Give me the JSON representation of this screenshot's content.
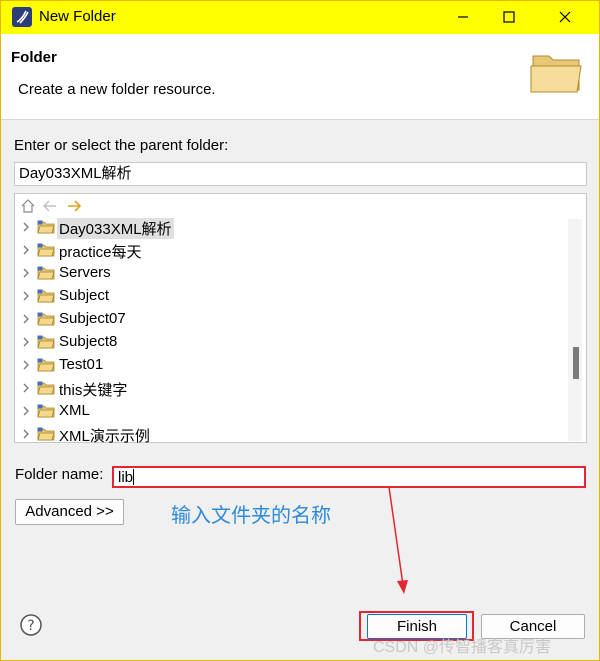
{
  "window": {
    "title": "New Folder",
    "title_bar_color": "#ffff00"
  },
  "banner": {
    "title": "Folder",
    "description": "Create a new folder resource."
  },
  "parent": {
    "prompt": "Enter or select the parent folder:",
    "value": "Day033XML解析"
  },
  "tree": {
    "items": [
      {
        "label": "Day033XML解析",
        "selected": true
      },
      {
        "label": "practice每天"
      },
      {
        "label": "Servers"
      },
      {
        "label": "Subject"
      },
      {
        "label": "Subject07"
      },
      {
        "label": "Subject8"
      },
      {
        "label": "Test01"
      },
      {
        "label": "this关键字"
      },
      {
        "label": "XML"
      },
      {
        "label": "XML演示示例"
      }
    ]
  },
  "folder_name": {
    "label": "Folder name:",
    "value": "lib"
  },
  "buttons": {
    "advanced": "Advanced >>",
    "finish": "Finish",
    "cancel": "Cancel"
  },
  "annotation": {
    "text": "输入文件夹的名称",
    "color": "#2e8bd9",
    "highlight_color": "#e3262f"
  },
  "watermark": "CSDN @传智播客真厉害"
}
